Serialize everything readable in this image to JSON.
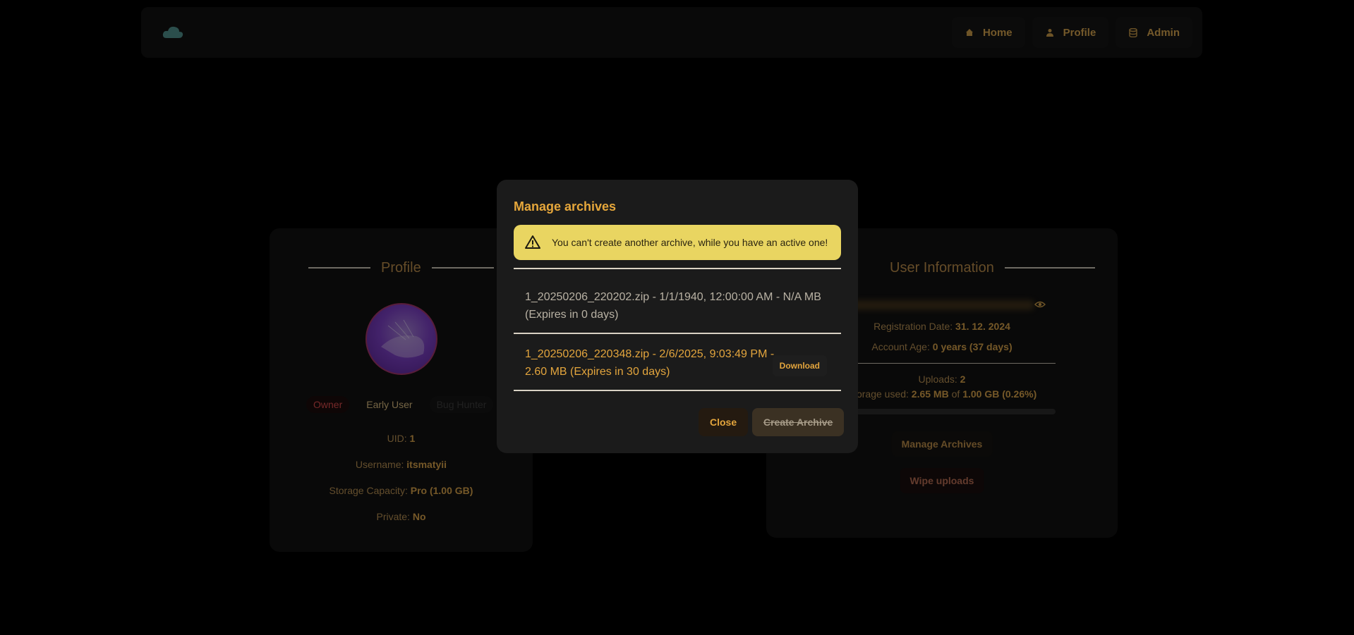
{
  "nav": {
    "links": [
      {
        "label": "Home",
        "icon": "home-icon"
      },
      {
        "label": "Profile",
        "icon": "user-icon"
      },
      {
        "label": "Admin",
        "icon": "database-icon"
      }
    ]
  },
  "profile": {
    "title": "Profile",
    "badges": [
      "Owner",
      "Early User",
      "Bug Hunter"
    ],
    "fields": [
      {
        "label": "UID:",
        "value": "1"
      },
      {
        "label": "Username:",
        "value": "itsmatyii"
      },
      {
        "label": "Storage Capacity:",
        "value": "Pro (1.00 GB)"
      },
      {
        "label": "Private:",
        "value": "No"
      }
    ]
  },
  "user_info": {
    "title": "User Information",
    "registration_label": "Registration Date:",
    "registration_value": "31. 12. 2024",
    "age_label": "Account Age:",
    "age_value": "0 years (37 days)",
    "uploads_label": "Uploads:",
    "uploads_value": "2",
    "storage_label": "Storage used:",
    "storage_used": "2.65 MB",
    "storage_of": "of",
    "storage_total": "1.00 GB",
    "storage_pct": "(0.26%)",
    "storage_fraction": 0.0026,
    "manage_button": "Manage Archives",
    "wipe_button": "Wipe uploads"
  },
  "modal": {
    "title": "Manage archives",
    "alert": "You can't create another archive, while you have an active one!",
    "archives": [
      {
        "text": "1_20250206_220202.zip - 1/1/1940, 12:00:00 AM - N/A MB (Expires in 0 days)",
        "expired": true
      },
      {
        "text": "1_20250206_220348.zip - 2/6/2025, 9:03:49 PM - 2.60 MB (Expires in 30 days)",
        "expired": false,
        "action": "Download"
      }
    ],
    "close_button": "Close",
    "create_button": "Create Archive"
  },
  "colors": {
    "accent": "#e3a53d",
    "alert_bg": "#e9d561",
    "owner": "#d44a4a"
  }
}
